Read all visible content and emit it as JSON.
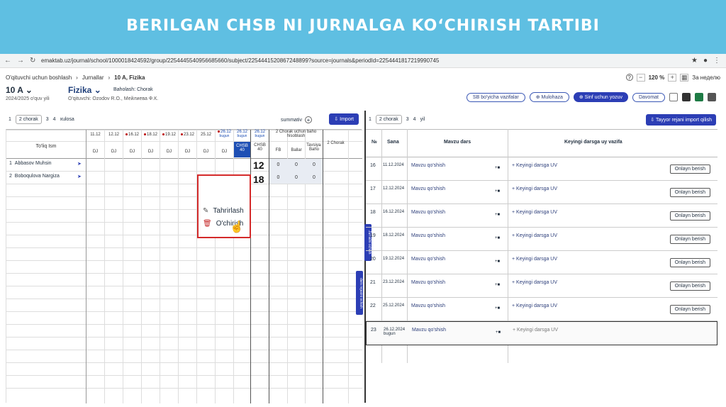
{
  "banner": {
    "title": "BERILGAN CHSB NI JURNALGA KO‘CHIRISH TARTIBI"
  },
  "browser": {
    "url": "emaktab.uz/journal/school/1000018424592/group/2254445540956685660/subject/2254441520867248899?source=journals&periodId=2254441817219990745"
  },
  "app": {
    "breadcrumbs": [
      "O'qituvchi uchun boshlash",
      "Jurnallar",
      "10 A, Fizika"
    ],
    "zoom": "120 %",
    "week": "За неделю",
    "class": "10 A",
    "year": "2024/2025 o'quv yili",
    "subject": "Fizika",
    "baholash": "Baholash: Chorak",
    "teacher": "O'qituvchi: Ozodov R.O., Мейлиева Ф.К.",
    "actions": [
      "SB bo'yicha vazifalar",
      "Mulohaza",
      "Sinf uchun yozuv",
      "Davomat"
    ],
    "left": {
      "tabs": [
        "1",
        "2 chorak",
        "3",
        "4",
        "xulosa"
      ],
      "summativ": "summativ",
      "import": "Import",
      "name_header": "To'liq Ism",
      "dates": [
        "11.12",
        "12.12",
        "16.12",
        "18.12",
        "19.12",
        "23.12",
        "25.12",
        "26.12",
        "26.12",
        "26.12"
      ],
      "bugun": "bugun",
      "dj": "DJ",
      "chsb_label": "CHSB",
      "chsb_val": "40",
      "chorak_header": "2 Chorak uchun baho hisoblash",
      "fb": "FB",
      "ballar": "Ballar",
      "tavsiya": "Tavsiya. Baho",
      "chorak2": "2 Chorak",
      "students": [
        {
          "n": "1",
          "name": "Abbasov Muhsin",
          "fb": "0",
          "ballar": "0",
          "baho": "0"
        },
        {
          "n": "2",
          "name": "Boboqulova Nargiza",
          "fb": "0",
          "ballar": "0",
          "baho": "0"
        }
      ],
      "menu": {
        "edit": "Tahrirlash",
        "delete": "O'chirish"
      },
      "big": [
        "12",
        "18"
      ]
    },
    "right": {
      "tabs": [
        "1",
        "2 chorak",
        "3",
        "4",
        "yil"
      ],
      "tayyor": "Tayyor rejani import qilish",
      "headers": {
        "n": "№",
        "sana": "Sana",
        "mavzu": "Mavzu dars",
        "keyingi": "Keyingi darsga uy vazifa"
      },
      "rows": [
        {
          "n": "16",
          "sana": "11.12.2024",
          "mavzu": "Mavzu qo'shish",
          "uv": "Keyingi darsga UV",
          "btn": "Onlayn berish"
        },
        {
          "n": "17",
          "sana": "12.12.2024",
          "mavzu": "Mavzu qo'shish",
          "uv": "Keyingi darsga UV",
          "btn": "Onlayn berish"
        },
        {
          "n": "18",
          "sana": "16.12.2024",
          "mavzu": "Mavzu qo'shish",
          "uv": "Keyingi darsga UV",
          "btn": "Onlayn berish"
        },
        {
          "n": "19",
          "sana": "18.12.2024",
          "mavzu": "Mavzu qo'shish",
          "uv": "Keyingi darsga UV",
          "btn": "Onlayn berish"
        },
        {
          "n": "20",
          "sana": "19.12.2024",
          "mavzu": "Mavzu qo'shish",
          "uv": "Keyingi darsga UV",
          "btn": "Onlayn berish"
        },
        {
          "n": "21",
          "sana": "23.12.2024",
          "mavzu": "Mavzu qo'shish",
          "uv": "Keyingi darsga UV",
          "btn": "Onlayn berish"
        },
        {
          "n": "22",
          "sana": "25.12.2024",
          "mavzu": "Mavzu qo'shish",
          "uv": "Keyingi darsga UV",
          "btn": "Onlayn berish"
        },
        {
          "n": "23",
          "sana": "26.12.2024",
          "sana2": "bugun",
          "mavzu": "Mavzu qo'shish",
          "uv": "Keyingi darsga UV",
          "btn": ""
        }
      ],
      "side1": "Jurnalni ochish",
      "side2": "dars rejasini ochish"
    }
  }
}
